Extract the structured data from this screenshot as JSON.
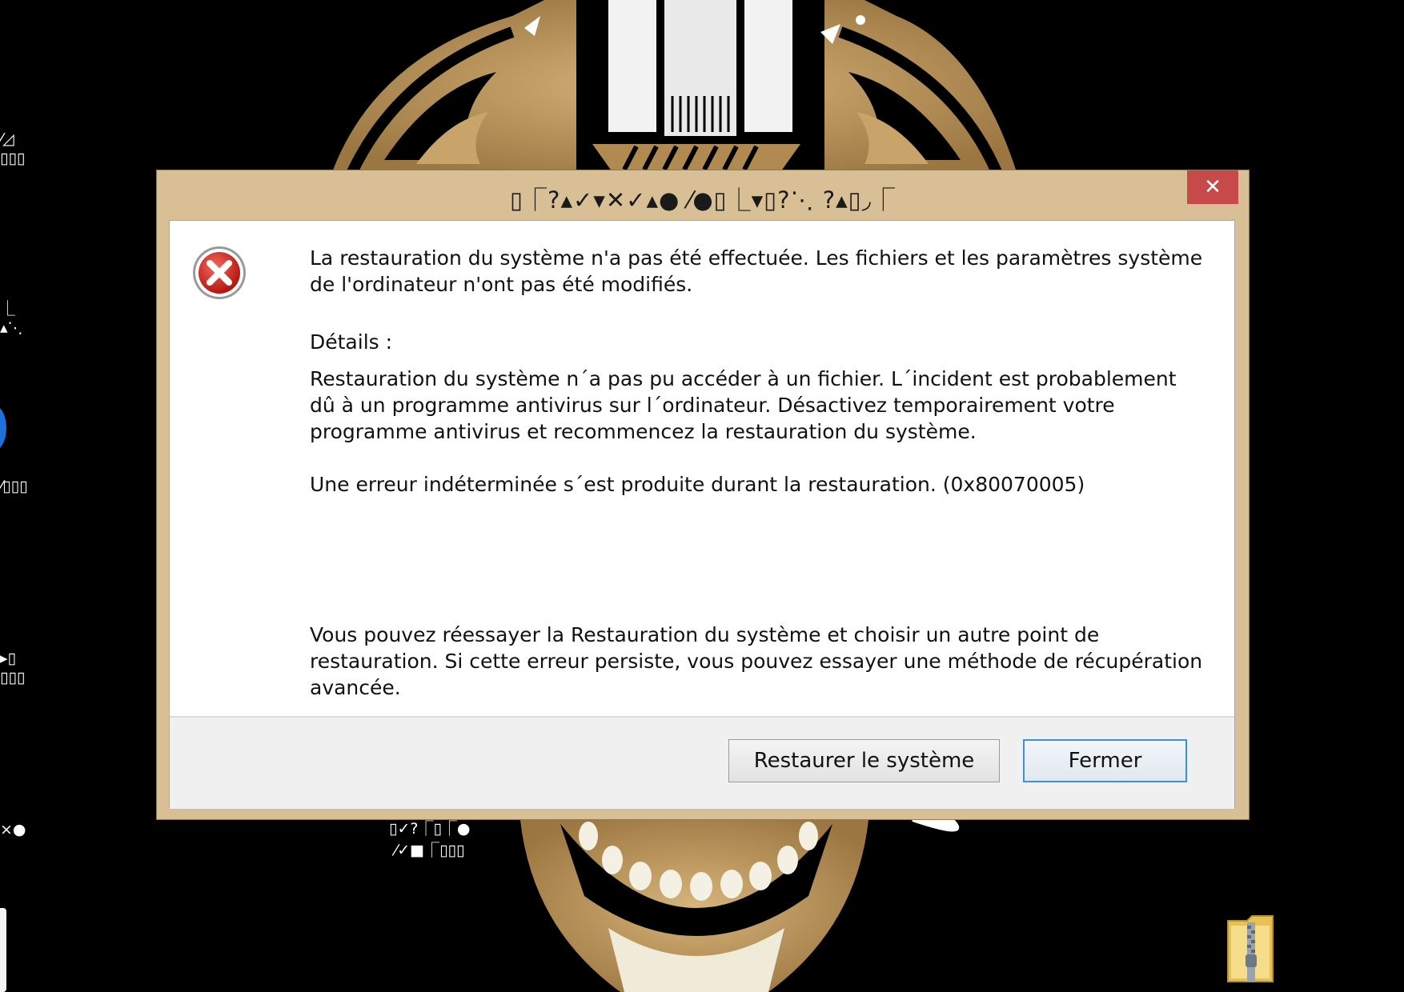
{
  "desktop": {
    "edge_labels": [
      "⁄◿\n▯▯▯",
      "⎿\n▴⋱",
      "⁄▯▯▯",
      "▸▯\n▯▯▯",
      "×●"
    ],
    "under_dialog_icon_label": "▯✓?⎾▯⎾●\n⁄✓■⎾▯▯▯"
  },
  "dialog": {
    "title": "▯⎾?▴✓▾✕✓▴● ⁄●▯⎿▾▯?⋱ ?▴▯◞⎾",
    "close_symbol": "✕",
    "icon": "error-icon",
    "main_message": "La restauration du système n'a pas été effectuée. Les fichiers et les paramètres système de l'ordinateur n'ont pas été modifiés.",
    "details_heading": "Détails  :",
    "details_text": "Restauration du système n´a pas pu accéder à un fichier. L´incident est probablement dû à un programme antivirus sur l´ordinateur. Désactivez temporairement votre programme antivirus et recommencez la restauration du système.",
    "error_code_line": "Une erreur indéterminée s´est produite durant la restauration. (0x80070005)",
    "advice_text": "Vous pouvez réessayer la Restauration du système et choisir un autre point de restauration. Si cette erreur persiste, vous pouvez essayer une méthode de récupération avancée.",
    "buttons": {
      "restore": "Restaurer le système",
      "close": "Fermer"
    }
  },
  "colors": {
    "titlebar": "#d8bf95",
    "close_button": "#c74949",
    "default_button_border": "#3c8fde",
    "wallpaper_gold": "#b08a50"
  }
}
